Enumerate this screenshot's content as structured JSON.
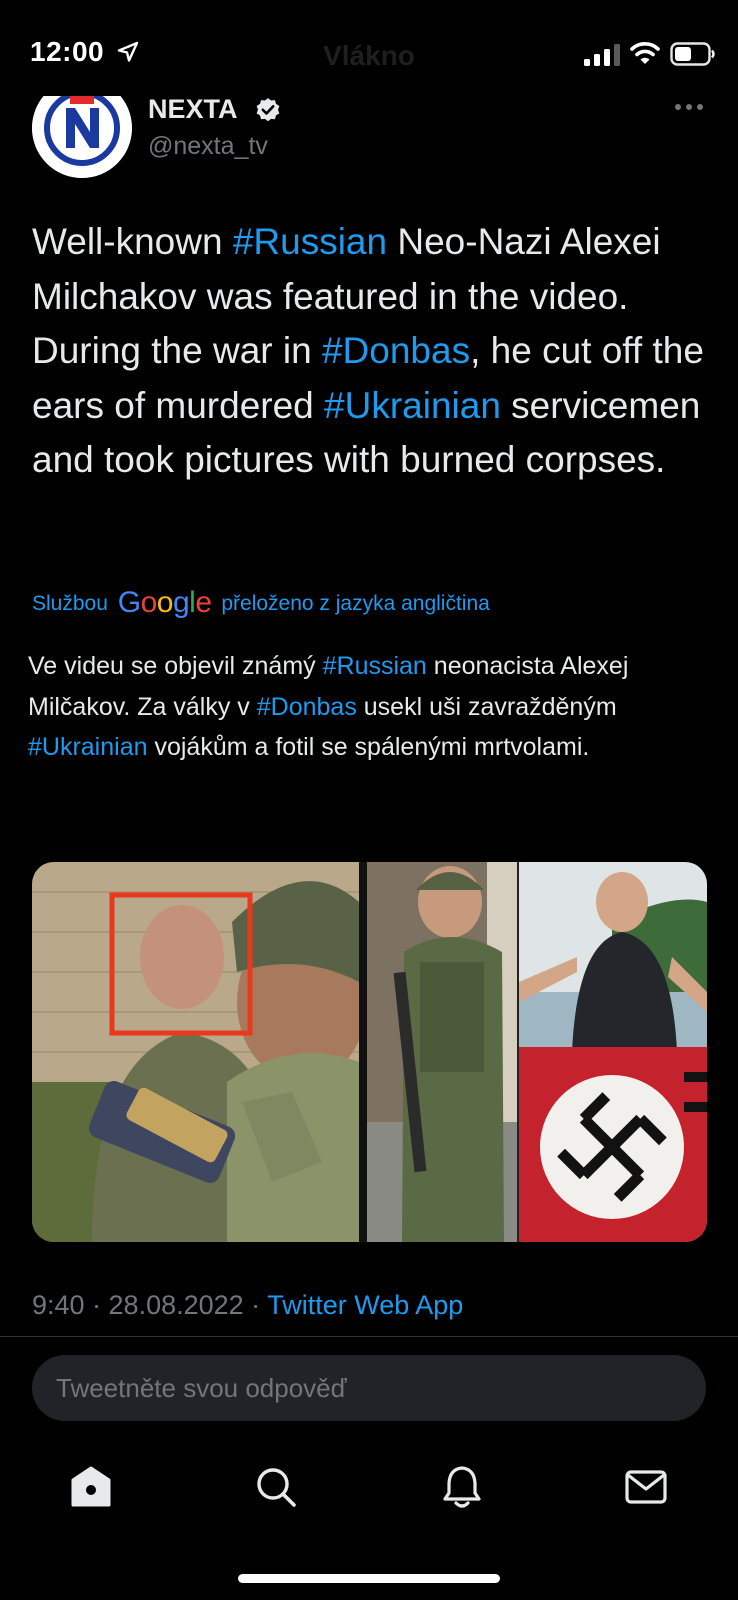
{
  "status_bar": {
    "time": "12:00",
    "header_title": "Vlákno",
    "icons": [
      "location-arrow-icon",
      "signal-icon",
      "wifi-icon",
      "battery-icon"
    ]
  },
  "tweet": {
    "author_name": "NEXTA",
    "author_handle": "@nexta_tv",
    "avatar_letter": "N",
    "text_segments": [
      {
        "text": "Well-known ",
        "hashtag": false
      },
      {
        "text": "#Russian",
        "hashtag": true
      },
      {
        "text": " Neo-Nazi Alexei Milchakov was featured in the video. During the war in ",
        "hashtag": false
      },
      {
        "text": "#Donbas",
        "hashtag": true
      },
      {
        "text": ", he cut off the ears of murdered ",
        "hashtag": false
      },
      {
        "text": "#Ukrainian",
        "hashtag": true
      },
      {
        "text": " servicemen and took pictures with burned corpses.",
        "hashtag": false
      }
    ],
    "translation_prefix": "Službou",
    "translation_brand": "Google",
    "translation_suffix": "přeloženo z jazyka angličtina",
    "translated_segments": [
      {
        "text": "Ve videu se objevil známý ",
        "hashtag": false
      },
      {
        "text": "#Russian",
        "hashtag": true
      },
      {
        "text": " neonacista Alexej Milčakov. Za války v ",
        "hashtag": false
      },
      {
        "text": "#Donbas",
        "hashtag": true
      },
      {
        "text": " usekl uši zavražděným ",
        "hashtag": false
      },
      {
        "text": "#Ukrainian",
        "hashtag": true
      },
      {
        "text": " vojákům a fotil se spálenými mrtvolami.",
        "hashtag": false
      }
    ],
    "timestamp": "9:40 · 28.08.2022 · ",
    "source": "Twitter Web App"
  },
  "reply": {
    "placeholder": "Tweetněte svou odpověď"
  },
  "tabs": [
    "home-icon",
    "search-icon",
    "notifications-icon",
    "messages-icon"
  ],
  "colors": {
    "accent": "#1d9bf0",
    "background": "#000000",
    "text": "#e7e9ea",
    "muted": "#71767b",
    "highlight_box": "#e8391e"
  }
}
